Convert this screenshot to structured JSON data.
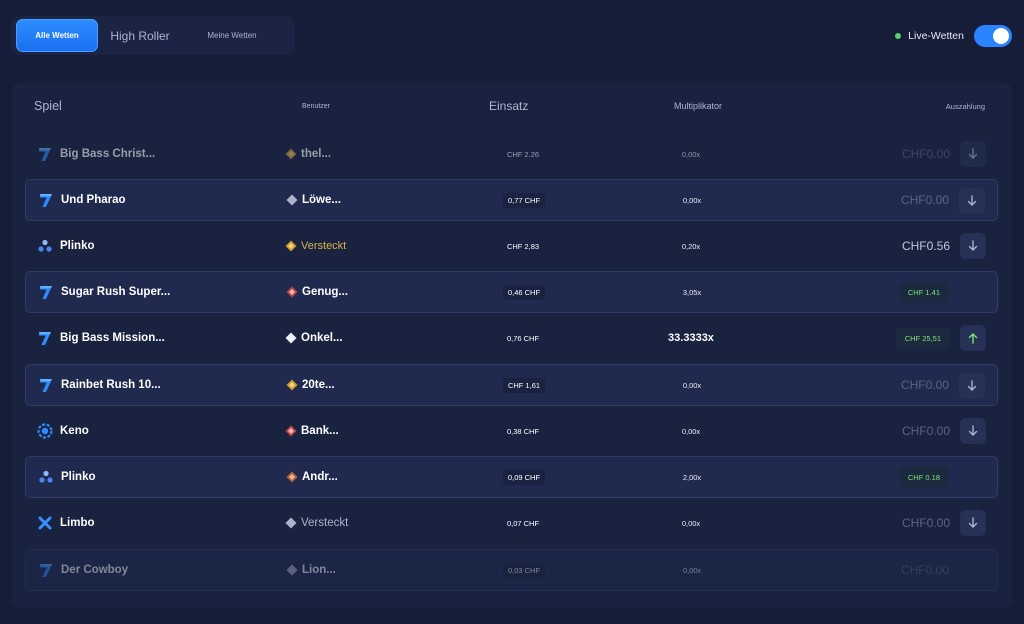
{
  "tabs": [
    {
      "label": "Alle Wetten",
      "active": true
    },
    {
      "label": "High Roller",
      "active": false
    },
    {
      "label": "Meine Wetten",
      "active": false
    }
  ],
  "live": {
    "label": "Live-Wetten",
    "enabled": true,
    "dot_color": "#57d36a",
    "toggle_color": "#2b84ff"
  },
  "table": {
    "headers": {
      "game": "Spiel",
      "user": "Benutzer",
      "stake": "Einsatz",
      "multiplier": "Multiplikator",
      "payout": "Auszahlung"
    },
    "rows": [
      {
        "game": "Big Bass Christ...",
        "game_icon": "seven-icon",
        "user": "thel...",
        "user_icon": "diamond-gold-icon",
        "stake": "CHF 2.26",
        "multiplier": "0,00x",
        "payout": "CHF0.00",
        "arrow": "down"
      },
      {
        "game": "Und Pharao",
        "game_icon": "seven-icon",
        "user": "Löwe...",
        "user_icon": "diamond-gray-icon",
        "stake": "0,77 CHF",
        "multiplier": "0,00x",
        "payout": "CHF0.00",
        "arrow": "down"
      },
      {
        "game": "Plinko",
        "game_icon": "plinko-icon",
        "user": "Versteckt",
        "user_icon": "diamond-gold-icon",
        "stake": "CHF 2,83",
        "multiplier": "0,20x",
        "payout": "CHF0.56",
        "arrow": "down"
      },
      {
        "game": "Sugar Rush Super...",
        "game_icon": "seven-icon",
        "user": "Genug...",
        "user_icon": "diamond-red-icon",
        "stake": "0,46 CHF",
        "multiplier": "3,05x",
        "payout": "CHF 1.41",
        "arrow": "none"
      },
      {
        "game": "Big Bass Mission...",
        "game_icon": "seven-icon",
        "user": "Onkel...",
        "user_icon": "diamond-white-icon",
        "stake": "0,76 CHF",
        "multiplier": "33.3333x",
        "payout": "CHF 25,51",
        "arrow": "up"
      },
      {
        "game": "Rainbet Rush 10...",
        "game_icon": "seven-icon",
        "user": "20te...",
        "user_icon": "diamond-gold-icon",
        "stake": "CHF 1,61",
        "multiplier": "0,00x",
        "payout": "CHF0.00",
        "arrow": "down"
      },
      {
        "game": "Keno",
        "game_icon": "keno-icon",
        "user": "Bank...",
        "user_icon": "diamond-red-icon",
        "stake": "0,38 CHF",
        "multiplier": "0,00x",
        "payout": "CHF0.00",
        "arrow": "down"
      },
      {
        "game": "Plinko",
        "game_icon": "plinko-icon",
        "user": "Andr...",
        "user_icon": "diamond-bronze-icon",
        "stake": "0,09 CHF",
        "multiplier": "2,00x",
        "payout": "CHF 0.18",
        "arrow": "none"
      },
      {
        "game": "Limbo",
        "game_icon": "limbo-icon",
        "user": "Versteckt",
        "user_icon": "diamond-gray-icon",
        "stake": "0,07 CHF",
        "multiplier": "0,00x",
        "payout": "CHF0.00",
        "arrow": "down"
      },
      {
        "game": "Der Cowboy",
        "game_icon": "seven-icon",
        "user": "Lion...",
        "user_icon": "diamond-gray-icon",
        "stake": "0,03 CHF",
        "multiplier": "0,00x",
        "payout": "CHF0.00",
        "arrow": "none"
      }
    ]
  }
}
